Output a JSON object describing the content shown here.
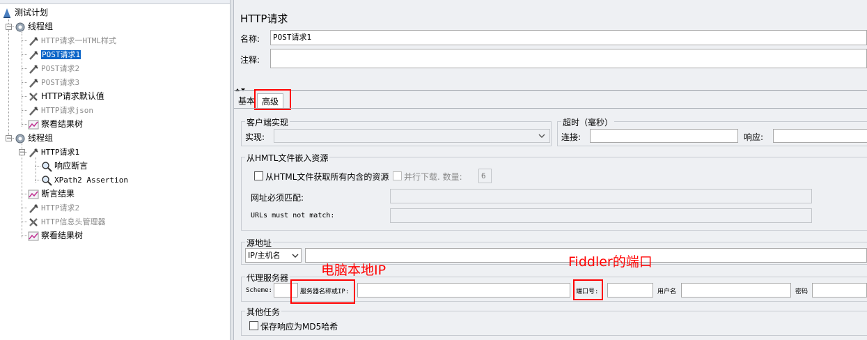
{
  "tree": {
    "items": [
      {
        "label": "测试计划",
        "icon": "test-plan-icon"
      },
      {
        "label": "线程组",
        "icon": "gear-icon"
      },
      {
        "label": "HTTP请求一HTML样式",
        "icon": "pipette-icon"
      },
      {
        "label": "POST请求1",
        "icon": "pipette-icon"
      },
      {
        "label": "POST请求2",
        "icon": "pipette-icon"
      },
      {
        "label": "POST请求3",
        "icon": "pipette-icon"
      },
      {
        "label": "HTTP请求默认值",
        "icon": "wrench-icon"
      },
      {
        "label": "HTTP请求json",
        "icon": "pipette-icon"
      },
      {
        "label": "察看结果树",
        "icon": "chart-icon"
      },
      {
        "label": "线程组",
        "icon": "gear-icon"
      },
      {
        "label": "HTTP请求1",
        "icon": "pipette-icon"
      },
      {
        "label": "响应断言",
        "icon": "magnifier-icon"
      },
      {
        "label": "XPath2 Assertion",
        "icon": "magnifier-icon"
      },
      {
        "label": "断言结果",
        "icon": "chart-icon"
      },
      {
        "label": "HTTP请求2",
        "icon": "pipette-icon"
      },
      {
        "label": "HTTP信息头管理器",
        "icon": "wrench-icon"
      },
      {
        "label": "察看结果树",
        "icon": "chart-icon"
      }
    ]
  },
  "panel": {
    "title": "HTTP请求",
    "name_label": "名称:",
    "name_value": "POST请求1",
    "comment_label": "注释:",
    "comment_value": ""
  },
  "tabs": {
    "basic": "基本",
    "advanced": "高级"
  },
  "client": {
    "group_title": "客户端实现",
    "impl_label": "实现:",
    "impl_value": ""
  },
  "timeout": {
    "group_title": "超时（毫秒）",
    "connect_label": "连接:",
    "response_label": "响应:"
  },
  "embedded": {
    "group_title": "从HMTL文件嵌入资源",
    "fetch_all_label": "从HTML文件获取所有内含的资源",
    "parallel_label": "并行下载. 数量:",
    "parallel_count": "6",
    "must_match_label": "网址必须匹配:",
    "must_not_match_label": "URLs must not match:"
  },
  "source": {
    "group_title": "源地址",
    "type_value": "IP/主机名"
  },
  "proxy": {
    "group_title": "代理服务器",
    "scheme_label": "Scheme:",
    "server_label": "服务器名称或IP:",
    "port_label": "端口号:",
    "username_label": "用户名",
    "password_label": "密码"
  },
  "other": {
    "group_title": "其他任务",
    "md5_label": "保存响应为MD5哈希"
  },
  "annotations": {
    "ip_note": "电脑本地IP",
    "port_note": "Fiddler的端口"
  },
  "colors": {
    "highlight": "#ff0000",
    "selection": "#0a64c8"
  }
}
